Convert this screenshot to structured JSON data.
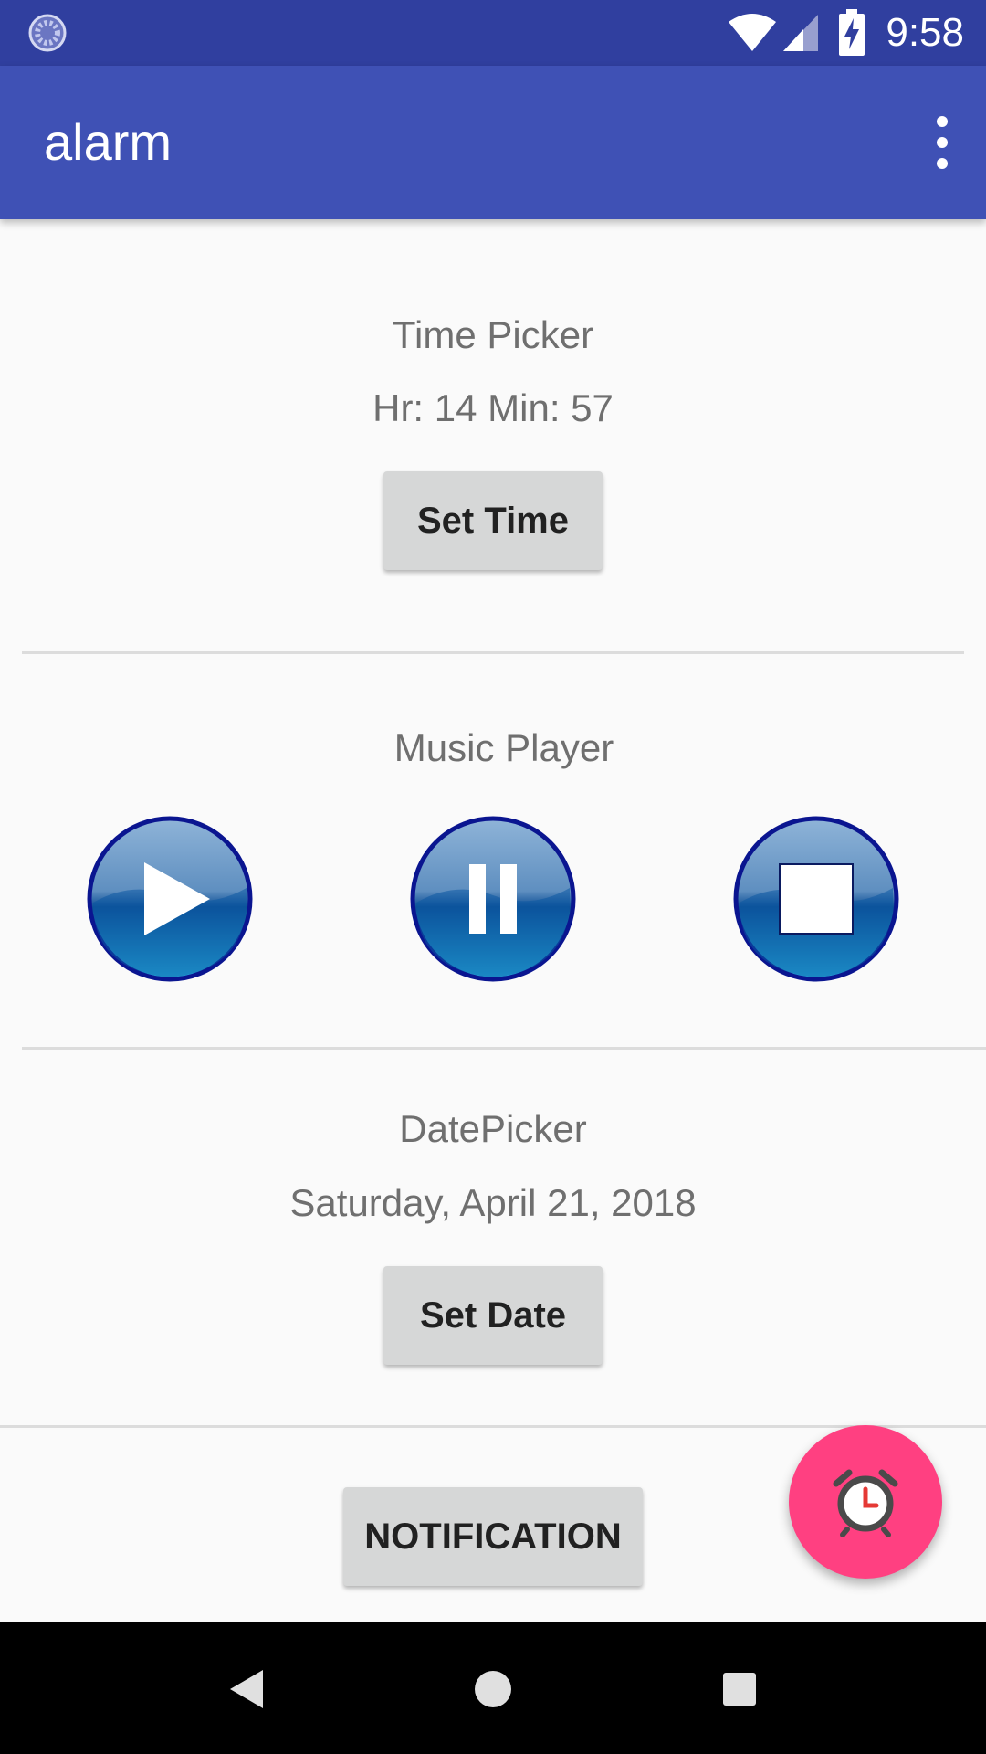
{
  "status_bar": {
    "time": "9:58",
    "icons": [
      "sync-icon",
      "wifi-icon",
      "cell-signal-icon",
      "battery-charging-icon"
    ]
  },
  "app_bar": {
    "title": "alarm",
    "menu_icon": "more-vert-icon"
  },
  "time_section": {
    "title": "Time Picker",
    "value": "Hr: 14 Min: 57",
    "button_label": "Set Time"
  },
  "music_section": {
    "title": "Music Player",
    "buttons": [
      "play-icon",
      "pause-icon",
      "stop-icon"
    ]
  },
  "date_section": {
    "title": "DatePicker",
    "value": "Saturday, April 21, 2018",
    "button_label": "Set Date"
  },
  "notification_button_label": "NOTIFICATION",
  "fab": {
    "icon": "alarm-clock-icon"
  },
  "nav_bar": {
    "icons": [
      "back-icon",
      "home-icon",
      "recents-icon"
    ]
  },
  "colors": {
    "status_bar": "#303f9f",
    "app_bar": "#3f51b5",
    "fab": "#ff4081",
    "background": "#fafafa"
  }
}
